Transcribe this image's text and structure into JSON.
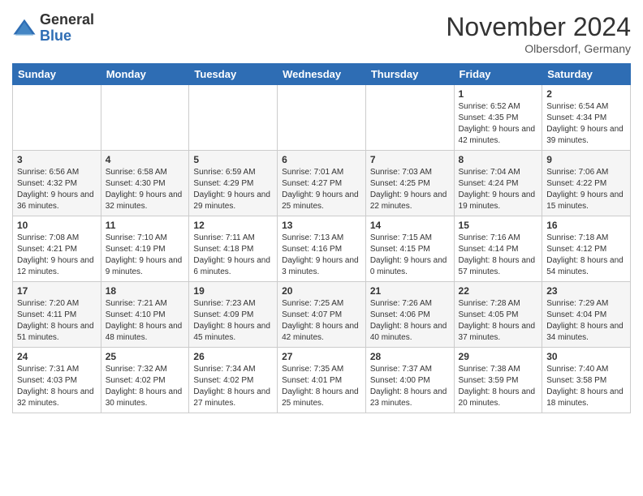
{
  "header": {
    "logo_general": "General",
    "logo_blue": "Blue",
    "month_title": "November 2024",
    "subtitle": "Olbersdorf, Germany"
  },
  "columns": [
    "Sunday",
    "Monday",
    "Tuesday",
    "Wednesday",
    "Thursday",
    "Friday",
    "Saturday"
  ],
  "weeks": [
    [
      {
        "day": "",
        "info": ""
      },
      {
        "day": "",
        "info": ""
      },
      {
        "day": "",
        "info": ""
      },
      {
        "day": "",
        "info": ""
      },
      {
        "day": "",
        "info": ""
      },
      {
        "day": "1",
        "info": "Sunrise: 6:52 AM\nSunset: 4:35 PM\nDaylight: 9 hours and 42 minutes."
      },
      {
        "day": "2",
        "info": "Sunrise: 6:54 AM\nSunset: 4:34 PM\nDaylight: 9 hours and 39 minutes."
      }
    ],
    [
      {
        "day": "3",
        "info": "Sunrise: 6:56 AM\nSunset: 4:32 PM\nDaylight: 9 hours and 36 minutes."
      },
      {
        "day": "4",
        "info": "Sunrise: 6:58 AM\nSunset: 4:30 PM\nDaylight: 9 hours and 32 minutes."
      },
      {
        "day": "5",
        "info": "Sunrise: 6:59 AM\nSunset: 4:29 PM\nDaylight: 9 hours and 29 minutes."
      },
      {
        "day": "6",
        "info": "Sunrise: 7:01 AM\nSunset: 4:27 PM\nDaylight: 9 hours and 25 minutes."
      },
      {
        "day": "7",
        "info": "Sunrise: 7:03 AM\nSunset: 4:25 PM\nDaylight: 9 hours and 22 minutes."
      },
      {
        "day": "8",
        "info": "Sunrise: 7:04 AM\nSunset: 4:24 PM\nDaylight: 9 hours and 19 minutes."
      },
      {
        "day": "9",
        "info": "Sunrise: 7:06 AM\nSunset: 4:22 PM\nDaylight: 9 hours and 15 minutes."
      }
    ],
    [
      {
        "day": "10",
        "info": "Sunrise: 7:08 AM\nSunset: 4:21 PM\nDaylight: 9 hours and 12 minutes."
      },
      {
        "day": "11",
        "info": "Sunrise: 7:10 AM\nSunset: 4:19 PM\nDaylight: 9 hours and 9 minutes."
      },
      {
        "day": "12",
        "info": "Sunrise: 7:11 AM\nSunset: 4:18 PM\nDaylight: 9 hours and 6 minutes."
      },
      {
        "day": "13",
        "info": "Sunrise: 7:13 AM\nSunset: 4:16 PM\nDaylight: 9 hours and 3 minutes."
      },
      {
        "day": "14",
        "info": "Sunrise: 7:15 AM\nSunset: 4:15 PM\nDaylight: 9 hours and 0 minutes."
      },
      {
        "day": "15",
        "info": "Sunrise: 7:16 AM\nSunset: 4:14 PM\nDaylight: 8 hours and 57 minutes."
      },
      {
        "day": "16",
        "info": "Sunrise: 7:18 AM\nSunset: 4:12 PM\nDaylight: 8 hours and 54 minutes."
      }
    ],
    [
      {
        "day": "17",
        "info": "Sunrise: 7:20 AM\nSunset: 4:11 PM\nDaylight: 8 hours and 51 minutes."
      },
      {
        "day": "18",
        "info": "Sunrise: 7:21 AM\nSunset: 4:10 PM\nDaylight: 8 hours and 48 minutes."
      },
      {
        "day": "19",
        "info": "Sunrise: 7:23 AM\nSunset: 4:09 PM\nDaylight: 8 hours and 45 minutes."
      },
      {
        "day": "20",
        "info": "Sunrise: 7:25 AM\nSunset: 4:07 PM\nDaylight: 8 hours and 42 minutes."
      },
      {
        "day": "21",
        "info": "Sunrise: 7:26 AM\nSunset: 4:06 PM\nDaylight: 8 hours and 40 minutes."
      },
      {
        "day": "22",
        "info": "Sunrise: 7:28 AM\nSunset: 4:05 PM\nDaylight: 8 hours and 37 minutes."
      },
      {
        "day": "23",
        "info": "Sunrise: 7:29 AM\nSunset: 4:04 PM\nDaylight: 8 hours and 34 minutes."
      }
    ],
    [
      {
        "day": "24",
        "info": "Sunrise: 7:31 AM\nSunset: 4:03 PM\nDaylight: 8 hours and 32 minutes."
      },
      {
        "day": "25",
        "info": "Sunrise: 7:32 AM\nSunset: 4:02 PM\nDaylight: 8 hours and 30 minutes."
      },
      {
        "day": "26",
        "info": "Sunrise: 7:34 AM\nSunset: 4:02 PM\nDaylight: 8 hours and 27 minutes."
      },
      {
        "day": "27",
        "info": "Sunrise: 7:35 AM\nSunset: 4:01 PM\nDaylight: 8 hours and 25 minutes."
      },
      {
        "day": "28",
        "info": "Sunrise: 7:37 AM\nSunset: 4:00 PM\nDaylight: 8 hours and 23 minutes."
      },
      {
        "day": "29",
        "info": "Sunrise: 7:38 AM\nSunset: 3:59 PM\nDaylight: 8 hours and 20 minutes."
      },
      {
        "day": "30",
        "info": "Sunrise: 7:40 AM\nSunset: 3:58 PM\nDaylight: 8 hours and 18 minutes."
      }
    ]
  ]
}
